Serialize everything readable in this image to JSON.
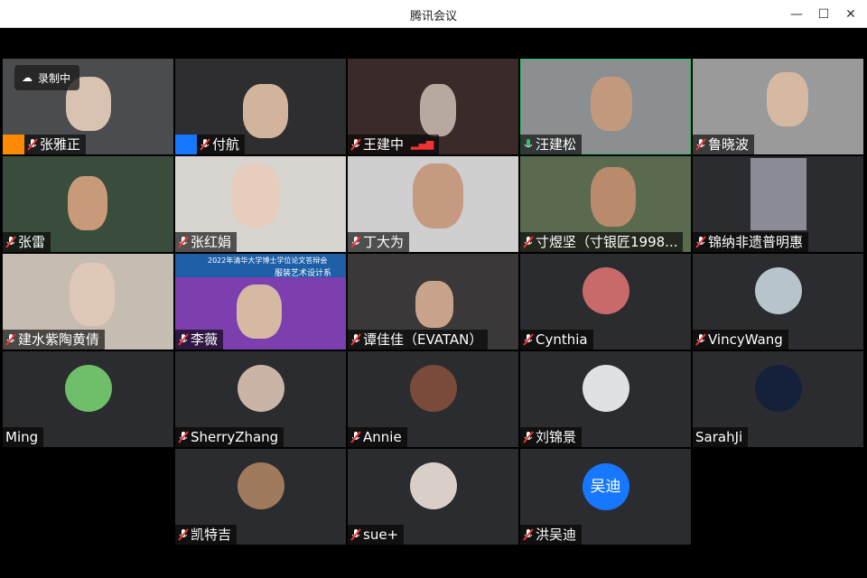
{
  "window": {
    "title": "腾讯会议"
  },
  "recording": {
    "label": "录制中"
  },
  "participants": [
    {
      "name": "张雅正",
      "video": true
    },
    {
      "name": "付航",
      "video": true
    },
    {
      "name": "王建中",
      "video": true
    },
    {
      "name": "汪建松",
      "video": true
    },
    {
      "name": "鲁晓波",
      "video": true
    },
    {
      "name": "张雷",
      "video": true
    },
    {
      "name": "张红娟",
      "video": true
    },
    {
      "name": "丁大为",
      "video": true
    },
    {
      "name": "寸煜坚（寸银匠1998...",
      "video": true
    },
    {
      "name": "锦纳非遗普明惠",
      "video": true
    },
    {
      "name": "建水紫陶黄倩",
      "video": true
    },
    {
      "name": "李薇",
      "video": true
    },
    {
      "name": "谭佳佳（EVATAN）",
      "video": true
    },
    {
      "name": "Cynthia",
      "video": false
    },
    {
      "name": "VincyWang",
      "video": false
    },
    {
      "name": "Ming",
      "video": false
    },
    {
      "name": "SherryZhang",
      "video": false
    },
    {
      "name": "Annie",
      "video": false
    },
    {
      "name": "刘锦景",
      "video": false
    },
    {
      "name": "SarahJi",
      "video": false
    },
    {
      "name": "凯特吉",
      "video": false
    },
    {
      "name": "sue+",
      "video": false
    },
    {
      "name": "洪吴迪",
      "video": false,
      "avatar_text": "吴迪"
    }
  ],
  "slide_banner": {
    "line1": "2022年清华大学博士学位论文答辩会",
    "line2": "服装艺术设计系"
  },
  "colors": {
    "accent": "#1677ff",
    "tile": "#2b2c2f",
    "active_border": "#29c46a"
  }
}
